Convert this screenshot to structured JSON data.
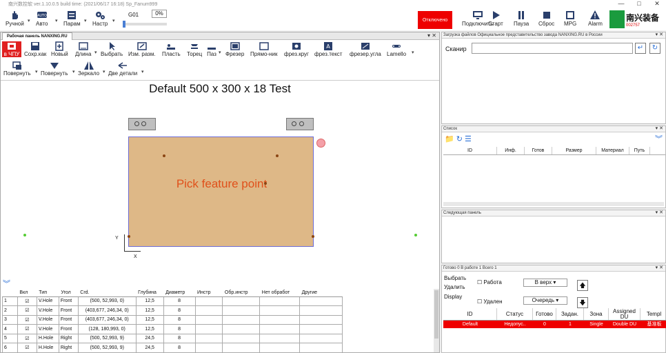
{
  "title_bar": {
    "text": "南兴数控软 ver.1.10.0.5 build time: (2021/06/17 16:18) Sp_Fanum999",
    "min": "—",
    "max": "□",
    "close": "✕"
  },
  "toolbar": {
    "manual": "Ручной",
    "auto": "Авто",
    "params": "Парам",
    "settings": "Настр",
    "g_code": "G01",
    "percent": "0%",
    "status": "Отключено",
    "connect": "Подключить",
    "start": "Старт",
    "pause": "Пауза",
    "reset": "Сброс",
    "mpg": "MPG",
    "alarm": "Alarm",
    "brand": "南兴装备",
    "brand_code": "002757"
  },
  "left_panel": {
    "tab": "Рабочая панель NANXING.RU",
    "pin": "▾ ✕",
    "ribbon": {
      "new_cnc": "в ЧПУ",
      "save_as": "Сохр.как",
      "new": "Новый",
      "length": "Длина",
      "select": "Выбрать",
      "resize": "Изм. разм.",
      "plate": "Пласть",
      "edge": "Торец",
      "groove": "Паз",
      "milling": "Фрезер",
      "rect": "Прямо-ник",
      "mill_circle": "фрез.круг",
      "mill_text": "фрез.текст",
      "mill_angle": "фрезер.угла",
      "lamello": "Lamello",
      "rotate": "Повернуть",
      "rotate2": "Повернуть",
      "mirror": "Зеркало",
      "two_parts": "Две детали"
    },
    "canvas": {
      "title": "Default  500 x 300 x 18 Test",
      "message": "Pick feature point",
      "y_axis": "Y",
      "x_axis": "X"
    },
    "table": {
      "columns": [
        "",
        "Вкл",
        "Тип",
        "Угол",
        "Crd.",
        "Глубина",
        "Диаметр",
        "Инстр",
        "Обр.инстр",
        "Нет обработ",
        "Другие"
      ],
      "rows": [
        [
          "1",
          "☑",
          "V.Hole",
          "Front",
          "(500, 52,993, 0)",
          "12,5",
          "8",
          "",
          "",
          "",
          ""
        ],
        [
          "2",
          "☑",
          "V.Hole",
          "Front",
          "(403,677, 246,34, 0)",
          "12,5",
          "8",
          "",
          "",
          "",
          ""
        ],
        [
          "3",
          "☑",
          "V.Hole",
          "Front",
          "(403,677, 246,34, 0)",
          "12,5",
          "8",
          "",
          "",
          "",
          ""
        ],
        [
          "4",
          "☑",
          "V.Hole",
          "Front",
          "(128, 180,993, 0)",
          "12,5",
          "8",
          "",
          "",
          "",
          ""
        ],
        [
          "5",
          "☑",
          "H.Hole",
          "Right",
          "(500, 52,993, 9)",
          "24,5",
          "8",
          "",
          "",
          "",
          ""
        ],
        [
          "6",
          "☑",
          "H.Hole",
          "Right",
          "(500, 52,993, 9)",
          "24,5",
          "8",
          "",
          "",
          "",
          ""
        ]
      ]
    }
  },
  "right_panels": {
    "file_load": {
      "header": "Загрузка файлов Официальное представительство завода NANXING.RU в России",
      "scanner_label": "Сканир",
      "scanner_value": "",
      "enter_btn": "↵",
      "refresh_btn": "↻"
    },
    "list": {
      "header": "Список",
      "columns": [
        "ID",
        "Инф.",
        "Готов",
        "Размер",
        "Материал",
        "Путь"
      ]
    },
    "next_panel": {
      "header": "Следующая панель"
    },
    "queue": {
      "tabs": "Готово 0   В работе 1   Всего 1",
      "select": "Выбрать",
      "delete": "Удалить",
      "display": "Display",
      "work_label": "Работа",
      "up_combo": "В верх",
      "deleted_label": "Удален",
      "queue_combo": "Очередь",
      "columns": [
        "ID",
        "Статус",
        "Готово",
        "Задан.",
        "Зона",
        "Assigned DU",
        "Templ"
      ],
      "row": [
        "Default",
        "Недопус..",
        "0",
        "1",
        "Single",
        "Double DU",
        "基准板"
      ]
    }
  }
}
